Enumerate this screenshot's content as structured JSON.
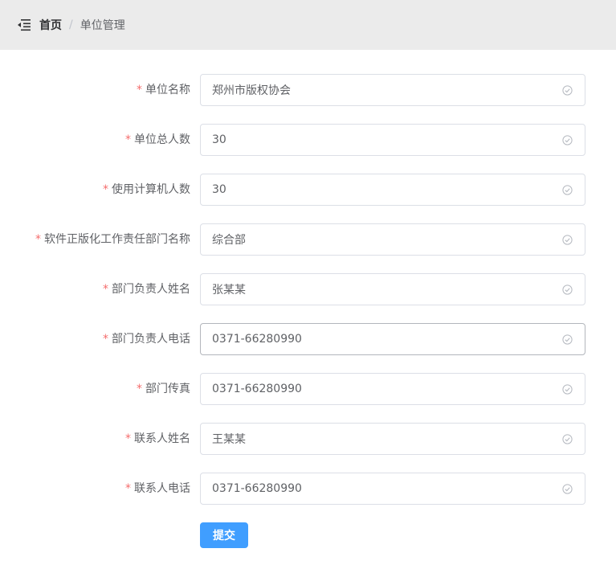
{
  "header": {
    "menu_icon": "menu-fold-icon",
    "breadcrumb": {
      "home": "首页",
      "separator": "/",
      "current": "单位管理"
    }
  },
  "form": {
    "required_mark": "*",
    "valid_icon": "circle-check-icon",
    "fields": [
      {
        "label": "单位名称",
        "value": "郑州市版权协会"
      },
      {
        "label": "单位总人数",
        "value": "30"
      },
      {
        "label": "使用计算机人数",
        "value": "30"
      },
      {
        "label": "软件正版化工作责任部门名称",
        "value": "综合部"
      },
      {
        "label": "部门负责人姓名",
        "value": "张某某"
      },
      {
        "label": "部门负责人电话",
        "value": "0371-66280990"
      },
      {
        "label": "部门传真",
        "value": "0371-66280990"
      },
      {
        "label": "联系人姓名",
        "value": "王某某"
      },
      {
        "label": "联系人电话",
        "value": "0371-66280990"
      }
    ],
    "submit_label": "提交"
  },
  "colors": {
    "header_bg": "#ebebeb",
    "required": "#f56c6c",
    "primary": "#409eff",
    "border": "#dcdfe6",
    "text": "#606266"
  }
}
